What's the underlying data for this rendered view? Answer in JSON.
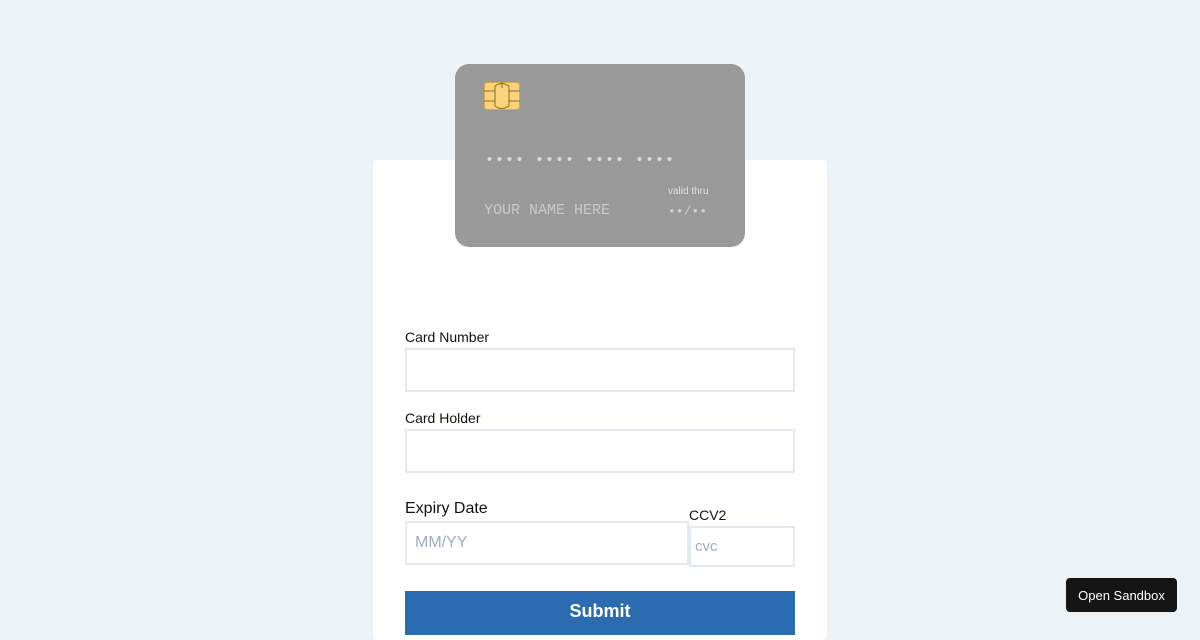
{
  "card_preview": {
    "chip_icon": "card-chip-icon",
    "chip_color": "#fcd27a",
    "number_placeholder": "•••• •••• •••• ••••",
    "holder_placeholder": "YOUR NAME HERE",
    "valid_thru_label": "valid thru",
    "expiry_placeholder": "••/••",
    "background_color": "#999999"
  },
  "form": {
    "card_number": {
      "label": "Card Number",
      "value": "",
      "placeholder": ""
    },
    "card_holder": {
      "label": "Card Holder",
      "value": "",
      "placeholder": ""
    },
    "expiry": {
      "label": "Expiry Date",
      "value": "",
      "placeholder": "MM/YY"
    },
    "cvv": {
      "label": "CCV2",
      "value": "",
      "placeholder": "cvc"
    },
    "submit_label": "Submit",
    "submit_color": "#2b6cb0"
  },
  "sandbox_button": {
    "label": "Open Sandbox"
  },
  "colors": {
    "page_background": "#edf2f7",
    "panel_background": "#ffffff",
    "input_border": "#e2e8f0",
    "placeholder": "#a0aec0"
  }
}
